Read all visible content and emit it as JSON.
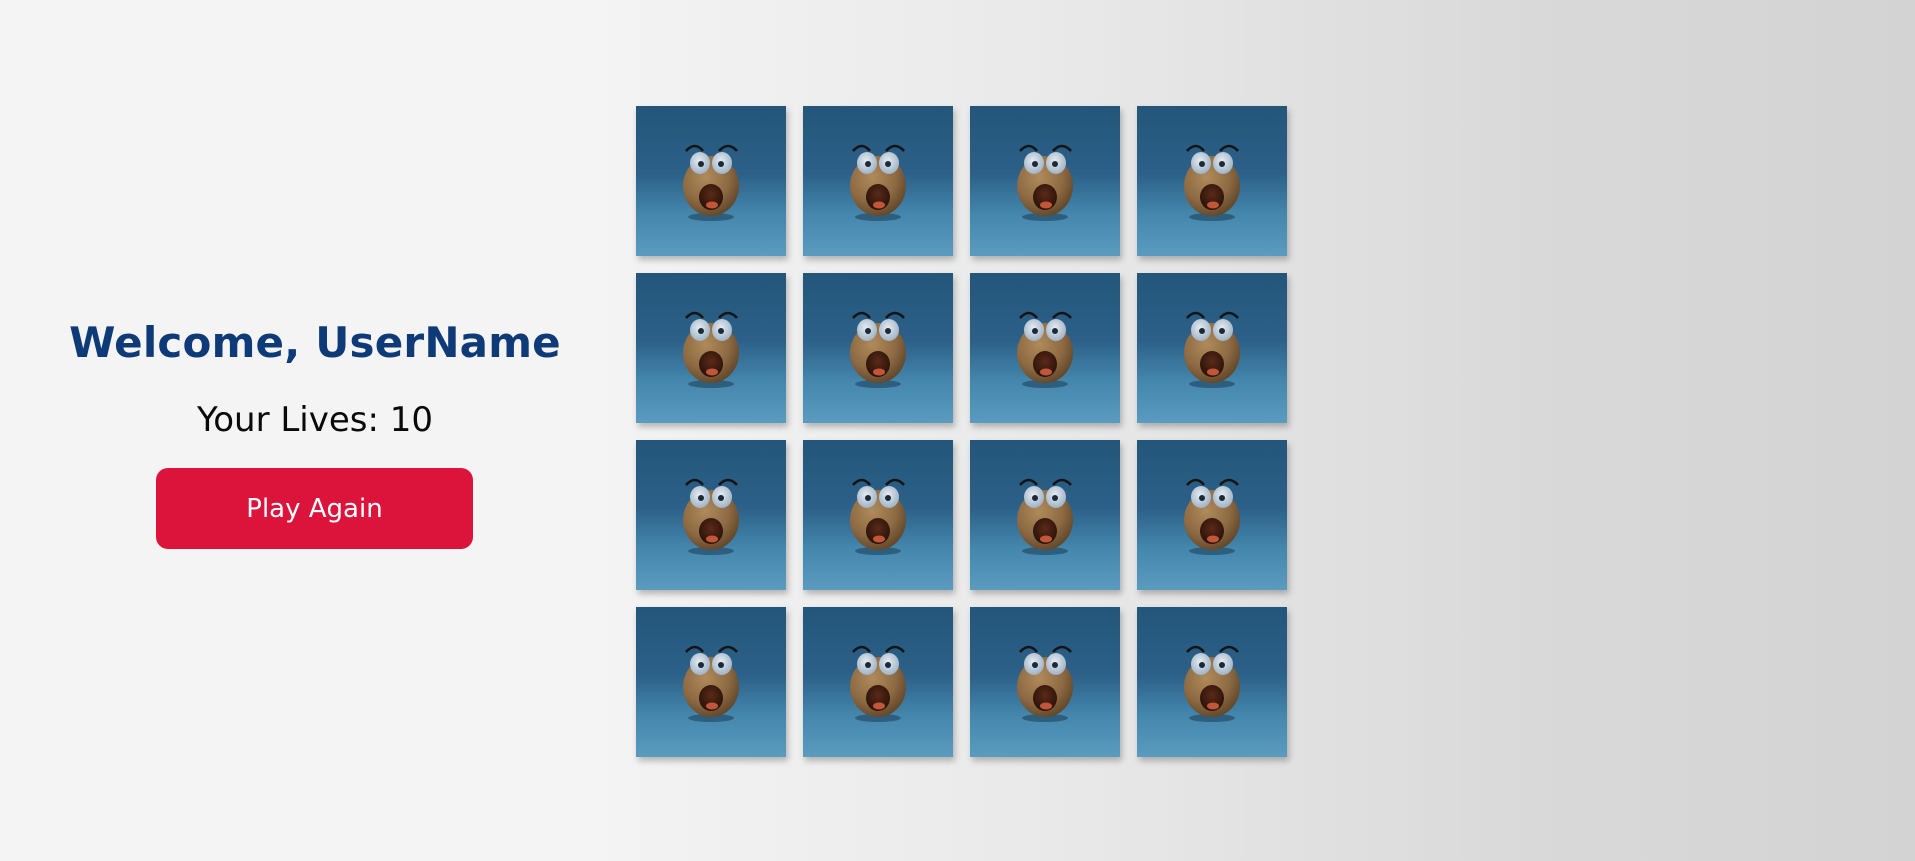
{
  "panel": {
    "welcome": "Welcome, UserName",
    "lives": "Your Lives: 10",
    "play_again_label": "Play Again"
  },
  "board": {
    "rows": 4,
    "columns": 4,
    "cards": [
      {
        "state": "face-down",
        "icon": "potato-face-icon"
      },
      {
        "state": "face-down",
        "icon": "potato-face-icon"
      },
      {
        "state": "face-down",
        "icon": "potato-face-icon"
      },
      {
        "state": "face-down",
        "icon": "potato-face-icon"
      },
      {
        "state": "face-down",
        "icon": "potato-face-icon"
      },
      {
        "state": "face-down",
        "icon": "potato-face-icon"
      },
      {
        "state": "face-down",
        "icon": "potato-face-icon"
      },
      {
        "state": "face-down",
        "icon": "potato-face-icon"
      },
      {
        "state": "face-down",
        "icon": "potato-face-icon"
      },
      {
        "state": "face-down",
        "icon": "potato-face-icon"
      },
      {
        "state": "face-down",
        "icon": "potato-face-icon"
      },
      {
        "state": "face-down",
        "icon": "potato-face-icon"
      },
      {
        "state": "face-down",
        "icon": "potato-face-icon"
      },
      {
        "state": "face-down",
        "icon": "potato-face-icon"
      },
      {
        "state": "face-down",
        "icon": "potato-face-icon"
      },
      {
        "state": "face-down",
        "icon": "potato-face-icon"
      }
    ]
  },
  "colors": {
    "welcome_text": "#0f3a78",
    "button_bg": "#dc143c",
    "button_text": "#ffffff",
    "card_bg_top": "#24567a",
    "card_bg_bottom": "#5b9bc0"
  }
}
